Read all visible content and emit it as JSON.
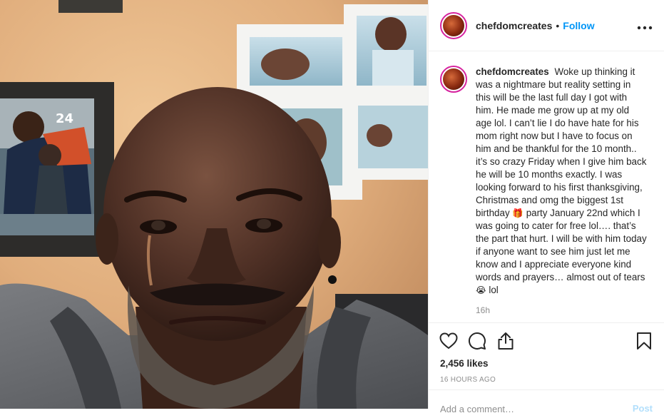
{
  "header": {
    "username": "chefdomcreates",
    "separator": "•",
    "follow_label": "Follow",
    "more_icon": "more-options-icon"
  },
  "caption": {
    "username": "chefdomcreates",
    "text_main": "Woke up thinking it was a nightmare but reality setting in this will be the last full day I got with him. He made me grow up at my old age lol. I can’t lie I do have hate for his mom right now but I have to focus on him and be thankful for the 10 month.. it’s so crazy Friday when I give him back he will be 10 months exactly. I was looking forward to his first thanksgiving, Christmas and omg the biggest 1st birthday",
    "emoji_gift": "🎁",
    "text_middle": "party January 22nd which I was going to cater for free lol…. that’s the part that hurt. I will be with him today if anyone want to see him just let me know and I appreciate everyone kind words and prayers… almost out of tears",
    "emoji_cry": "😭",
    "text_end": "lol",
    "time": "16h"
  },
  "actions": {
    "icons": [
      "heart-icon",
      "comment-icon",
      "share-icon",
      "bookmark-icon"
    ]
  },
  "likes": "2,456 likes",
  "timestamp": "16 HOURS AGO",
  "add_comment": {
    "placeholder": "Add a comment…",
    "post_label": "Post"
  },
  "photo": {
    "jersey_number": "24"
  },
  "colors": {
    "follow_blue": "#0095f6",
    "post_disabled": "#b2dffc",
    "avatar_ring": "#d6249f",
    "wall": "#e2b383"
  }
}
